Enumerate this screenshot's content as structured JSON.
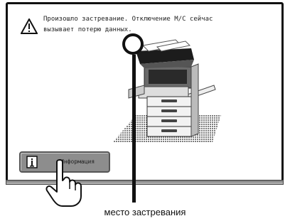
{
  "message": {
    "line1": "Произошло застревание. Отключение М/С сейчас",
    "line2": "вызывает потерю данных."
  },
  "info_button": {
    "label": "Информация"
  },
  "caption": "место застревания",
  "colors": {
    "accent_line": "#111111",
    "button_bg": "#8d8d8d"
  },
  "icons": [
    "warning-icon",
    "info-icon",
    "hand-pointer-icon",
    "printer-illustration"
  ]
}
